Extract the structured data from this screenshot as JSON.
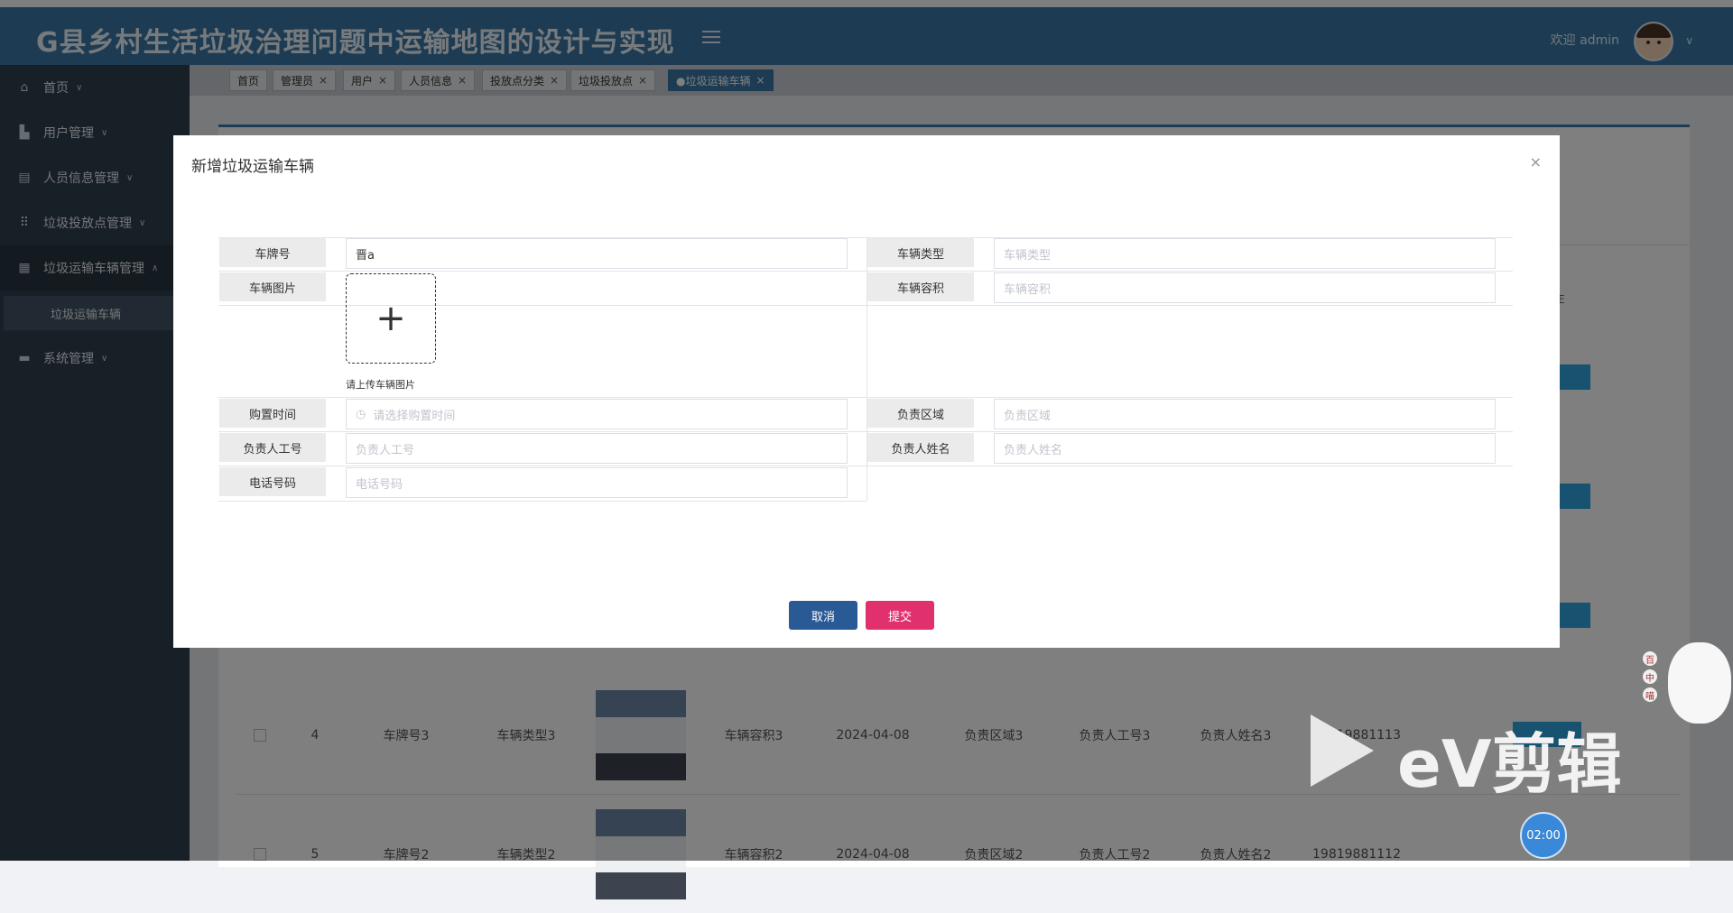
{
  "header": {
    "app_title": "G县乡村生活垃圾治理问题中运输地图的设计与实现",
    "welcome": "欢迎 admin",
    "caret": "∨"
  },
  "sidebar": {
    "items": [
      {
        "label": "首页",
        "icon": "home-icon",
        "glyph": "⌂",
        "caret": "∨"
      },
      {
        "label": "用户管理",
        "icon": "building-icon",
        "glyph": "▙",
        "caret": "∨"
      },
      {
        "label": "人员信息管理",
        "icon": "layers-icon",
        "glyph": "▤",
        "caret": "∨"
      },
      {
        "label": "垃圾投放点管理",
        "icon": "grid-dots-icon",
        "glyph": "⠿",
        "caret": "∨"
      },
      {
        "label": "垃圾运输车辆管理",
        "icon": "apartment-icon",
        "glyph": "▦",
        "caret": "∧"
      }
    ],
    "sub_item": "垃圾运输车辆",
    "last_item": {
      "label": "系统管理",
      "icon": "server-icon",
      "glyph": "▬",
      "caret": "∨"
    }
  },
  "tabs": [
    {
      "label": "首页",
      "closable": false
    },
    {
      "label": "管理员",
      "closable": true
    },
    {
      "label": "用户",
      "closable": true
    },
    {
      "label": "人员信息",
      "closable": true
    },
    {
      "label": "投放点分类",
      "closable": true
    },
    {
      "label": "垃圾投放点",
      "closable": true
    },
    {
      "label": "●垃圾运输车辆",
      "closable": true,
      "active": true
    }
  ],
  "table": {
    "header_fragment": "E",
    "rows": [
      {
        "index": "4",
        "plate": "车牌号3",
        "type": "车辆类型3",
        "capacity": "车辆容积3",
        "date": "2024-04-08",
        "area": "负责区域3",
        "staff_id": "负责人工号3",
        "staff_name": "负责人姓名3",
        "phone": "19819881113"
      },
      {
        "index": "5",
        "plate": "车牌号2",
        "type": "车辆类型2",
        "capacity": "车辆容积2",
        "date": "2024-04-08",
        "area": "负责区域2",
        "staff_id": "负责人工号2",
        "staff_name": "负责人姓名2",
        "phone": "19819881112"
      }
    ]
  },
  "modal": {
    "title": "新增垃圾运输车辆",
    "close": "×",
    "fields": {
      "plate": {
        "label": "车牌号",
        "value": "晋a"
      },
      "vehicle_type": {
        "label": "车辆类型",
        "placeholder": "车辆类型"
      },
      "vehicle_image": {
        "label": "车辆图片",
        "upload_tip": "请上传车辆图片",
        "plus": "+"
      },
      "capacity": {
        "label": "车辆容积",
        "placeholder": "车辆容积"
      },
      "purchase_time": {
        "label": "购置时间",
        "placeholder": "请选择购置时间",
        "icon": "◷"
      },
      "area": {
        "label": "负责区域",
        "placeholder": "负责区域"
      },
      "staff_id": {
        "label": "负责人工号",
        "placeholder": "负责人工号"
      },
      "staff_name": {
        "label": "负责人姓名",
        "placeholder": "负责人姓名"
      },
      "phone": {
        "label": "电话号码",
        "placeholder": "电话号码"
      }
    },
    "buttons": {
      "cancel": "取消",
      "submit": "提交"
    }
  },
  "overlay_branding": {
    "ev_text": "eV剪辑",
    "timer": "02:00",
    "mascot_tags": [
      "百",
      "中",
      "喵"
    ]
  },
  "colors": {
    "header": "#3a79a7",
    "sidebar": "#2f3f4e",
    "cancel": "#2a5a96",
    "submit": "#e0306e"
  }
}
